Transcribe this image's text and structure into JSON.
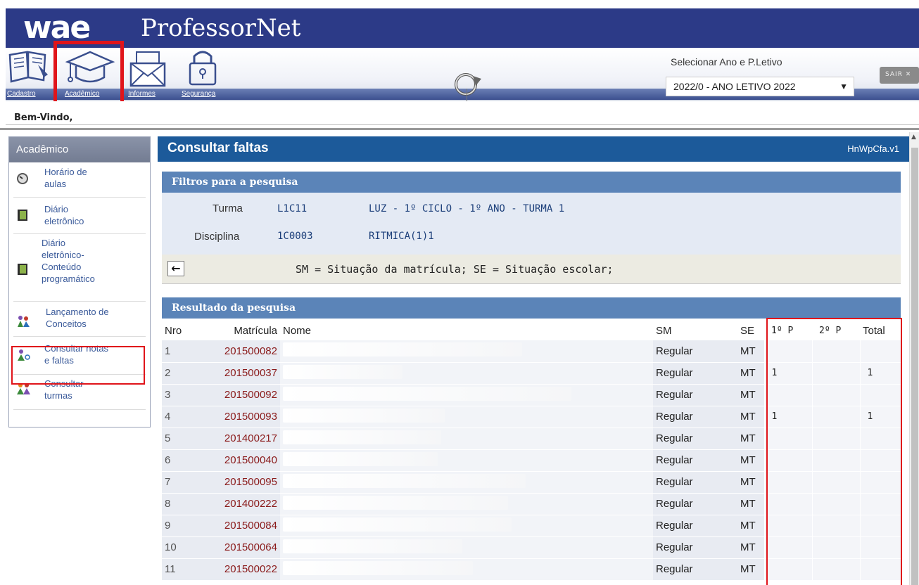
{
  "header": {
    "logo": "wae",
    "product": "ProfessorNet",
    "tools": [
      {
        "label": "Cadastro",
        "icon": "book-icon"
      },
      {
        "label": "Acadêmico",
        "icon": "graduation-cap-icon"
      },
      {
        "label": "Informes",
        "icon": "mail-icon"
      },
      {
        "label": "Segurança",
        "icon": "lock-icon"
      }
    ],
    "select_label": "Selecionar Ano e P.Letivo",
    "select_value": "2022/0 - ANO LETIVO 2022",
    "logout_label": "SAIR ✕",
    "welcome": "Bem-Vindo,"
  },
  "sidebar": {
    "title": "Acadêmico",
    "items": [
      {
        "label": "Horário de\naulas",
        "icon": "clock-icon"
      },
      {
        "label": "Diário\neletrônico",
        "icon": "notebook-icon"
      },
      {
        "label": "Diário\neletrônico-\nConteúdo\nprogramático",
        "icon": "notebook-icon"
      },
      {
        "label": "Lançamento de\nConceitos",
        "icon": "students-icon"
      },
      {
        "label": "Consultar notas\ne faltas",
        "icon": "student-search-icon"
      },
      {
        "label": "Consultar\nturmas",
        "icon": "group-icon"
      }
    ]
  },
  "main": {
    "title": "Consultar faltas",
    "version": "HnWpCfa.v1",
    "filters_title": "Filtros para a pesquisa",
    "turma_label": "Turma",
    "turma_code": "L1C11",
    "turma_desc": "LUZ - 1º CICLO - 1º ANO - TURMA 1",
    "disciplina_label": "Disciplina",
    "disciplina_code": "1C0003",
    "disciplina_desc": "RITMICA(1)1",
    "legend": "SM = Situação da matrícula; SE = Situação escolar;",
    "results_title": "Resultado da pesquisa",
    "columns": [
      "Nro",
      "Matrícula",
      "Nome",
      "SM",
      "SE",
      "1º P",
      "2º P",
      "Total"
    ],
    "rows": [
      {
        "nro": "1",
        "mat": "201500082",
        "sm": "Regular",
        "se": "MT",
        "p1": "",
        "p2": "",
        "total": ""
      },
      {
        "nro": "2",
        "mat": "201500037",
        "sm": "Regular",
        "se": "MT",
        "p1": "1",
        "p2": "",
        "total": "1"
      },
      {
        "nro": "3",
        "mat": "201500092",
        "sm": "Regular",
        "se": "MT",
        "p1": "",
        "p2": "",
        "total": ""
      },
      {
        "nro": "4",
        "mat": "201500093",
        "sm": "Regular",
        "se": "MT",
        "p1": "1",
        "p2": "",
        "total": "1"
      },
      {
        "nro": "5",
        "mat": "201400217",
        "sm": "Regular",
        "se": "MT",
        "p1": "",
        "p2": "",
        "total": ""
      },
      {
        "nro": "6",
        "mat": "201500040",
        "sm": "Regular",
        "se": "MT",
        "p1": "",
        "p2": "",
        "total": ""
      },
      {
        "nro": "7",
        "mat": "201500095",
        "sm": "Regular",
        "se": "MT",
        "p1": "",
        "p2": "",
        "total": ""
      },
      {
        "nro": "8",
        "mat": "201400222",
        "sm": "Regular",
        "se": "MT",
        "p1": "",
        "p2": "",
        "total": ""
      },
      {
        "nro": "9",
        "mat": "201500084",
        "sm": "Regular",
        "se": "MT",
        "p1": "",
        "p2": "",
        "total": ""
      },
      {
        "nro": "10",
        "mat": "201500064",
        "sm": "Regular",
        "se": "MT",
        "p1": "",
        "p2": "",
        "total": ""
      },
      {
        "nro": "11",
        "mat": "201500022",
        "sm": "Regular",
        "se": "MT",
        "p1": "",
        "p2": "",
        "total": ""
      }
    ]
  },
  "colors": {
    "banner": "#2c3a87",
    "title_bar": "#1c5a9a",
    "panel_header": "#5b84b8",
    "highlight": "#e0141a"
  }
}
